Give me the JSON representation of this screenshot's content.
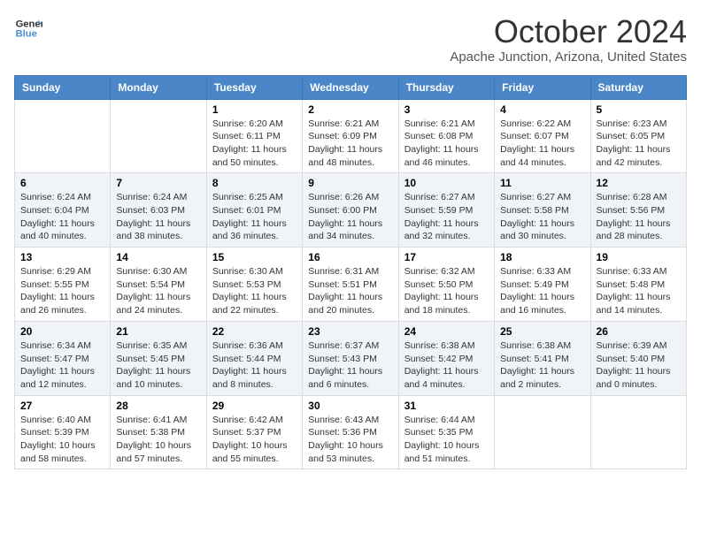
{
  "logo": {
    "line1": "General",
    "line2": "Blue"
  },
  "title": "October 2024",
  "location": "Apache Junction, Arizona, United States",
  "days_of_week": [
    "Sunday",
    "Monday",
    "Tuesday",
    "Wednesday",
    "Thursday",
    "Friday",
    "Saturday"
  ],
  "weeks": [
    [
      {
        "day": "",
        "info": ""
      },
      {
        "day": "",
        "info": ""
      },
      {
        "day": "1",
        "info": "Sunrise: 6:20 AM\nSunset: 6:11 PM\nDaylight: 11 hours and 50 minutes."
      },
      {
        "day": "2",
        "info": "Sunrise: 6:21 AM\nSunset: 6:09 PM\nDaylight: 11 hours and 48 minutes."
      },
      {
        "day": "3",
        "info": "Sunrise: 6:21 AM\nSunset: 6:08 PM\nDaylight: 11 hours and 46 minutes."
      },
      {
        "day": "4",
        "info": "Sunrise: 6:22 AM\nSunset: 6:07 PM\nDaylight: 11 hours and 44 minutes."
      },
      {
        "day": "5",
        "info": "Sunrise: 6:23 AM\nSunset: 6:05 PM\nDaylight: 11 hours and 42 minutes."
      }
    ],
    [
      {
        "day": "6",
        "info": "Sunrise: 6:24 AM\nSunset: 6:04 PM\nDaylight: 11 hours and 40 minutes."
      },
      {
        "day": "7",
        "info": "Sunrise: 6:24 AM\nSunset: 6:03 PM\nDaylight: 11 hours and 38 minutes."
      },
      {
        "day": "8",
        "info": "Sunrise: 6:25 AM\nSunset: 6:01 PM\nDaylight: 11 hours and 36 minutes."
      },
      {
        "day": "9",
        "info": "Sunrise: 6:26 AM\nSunset: 6:00 PM\nDaylight: 11 hours and 34 minutes."
      },
      {
        "day": "10",
        "info": "Sunrise: 6:27 AM\nSunset: 5:59 PM\nDaylight: 11 hours and 32 minutes."
      },
      {
        "day": "11",
        "info": "Sunrise: 6:27 AM\nSunset: 5:58 PM\nDaylight: 11 hours and 30 minutes."
      },
      {
        "day": "12",
        "info": "Sunrise: 6:28 AM\nSunset: 5:56 PM\nDaylight: 11 hours and 28 minutes."
      }
    ],
    [
      {
        "day": "13",
        "info": "Sunrise: 6:29 AM\nSunset: 5:55 PM\nDaylight: 11 hours and 26 minutes."
      },
      {
        "day": "14",
        "info": "Sunrise: 6:30 AM\nSunset: 5:54 PM\nDaylight: 11 hours and 24 minutes."
      },
      {
        "day": "15",
        "info": "Sunrise: 6:30 AM\nSunset: 5:53 PM\nDaylight: 11 hours and 22 minutes."
      },
      {
        "day": "16",
        "info": "Sunrise: 6:31 AM\nSunset: 5:51 PM\nDaylight: 11 hours and 20 minutes."
      },
      {
        "day": "17",
        "info": "Sunrise: 6:32 AM\nSunset: 5:50 PM\nDaylight: 11 hours and 18 minutes."
      },
      {
        "day": "18",
        "info": "Sunrise: 6:33 AM\nSunset: 5:49 PM\nDaylight: 11 hours and 16 minutes."
      },
      {
        "day": "19",
        "info": "Sunrise: 6:33 AM\nSunset: 5:48 PM\nDaylight: 11 hours and 14 minutes."
      }
    ],
    [
      {
        "day": "20",
        "info": "Sunrise: 6:34 AM\nSunset: 5:47 PM\nDaylight: 11 hours and 12 minutes."
      },
      {
        "day": "21",
        "info": "Sunrise: 6:35 AM\nSunset: 5:45 PM\nDaylight: 11 hours and 10 minutes."
      },
      {
        "day": "22",
        "info": "Sunrise: 6:36 AM\nSunset: 5:44 PM\nDaylight: 11 hours and 8 minutes."
      },
      {
        "day": "23",
        "info": "Sunrise: 6:37 AM\nSunset: 5:43 PM\nDaylight: 11 hours and 6 minutes."
      },
      {
        "day": "24",
        "info": "Sunrise: 6:38 AM\nSunset: 5:42 PM\nDaylight: 11 hours and 4 minutes."
      },
      {
        "day": "25",
        "info": "Sunrise: 6:38 AM\nSunset: 5:41 PM\nDaylight: 11 hours and 2 minutes."
      },
      {
        "day": "26",
        "info": "Sunrise: 6:39 AM\nSunset: 5:40 PM\nDaylight: 11 hours and 0 minutes."
      }
    ],
    [
      {
        "day": "27",
        "info": "Sunrise: 6:40 AM\nSunset: 5:39 PM\nDaylight: 10 hours and 58 minutes."
      },
      {
        "day": "28",
        "info": "Sunrise: 6:41 AM\nSunset: 5:38 PM\nDaylight: 10 hours and 57 minutes."
      },
      {
        "day": "29",
        "info": "Sunrise: 6:42 AM\nSunset: 5:37 PM\nDaylight: 10 hours and 55 minutes."
      },
      {
        "day": "30",
        "info": "Sunrise: 6:43 AM\nSunset: 5:36 PM\nDaylight: 10 hours and 53 minutes."
      },
      {
        "day": "31",
        "info": "Sunrise: 6:44 AM\nSunset: 5:35 PM\nDaylight: 10 hours and 51 minutes."
      },
      {
        "day": "",
        "info": ""
      },
      {
        "day": "",
        "info": ""
      }
    ]
  ]
}
